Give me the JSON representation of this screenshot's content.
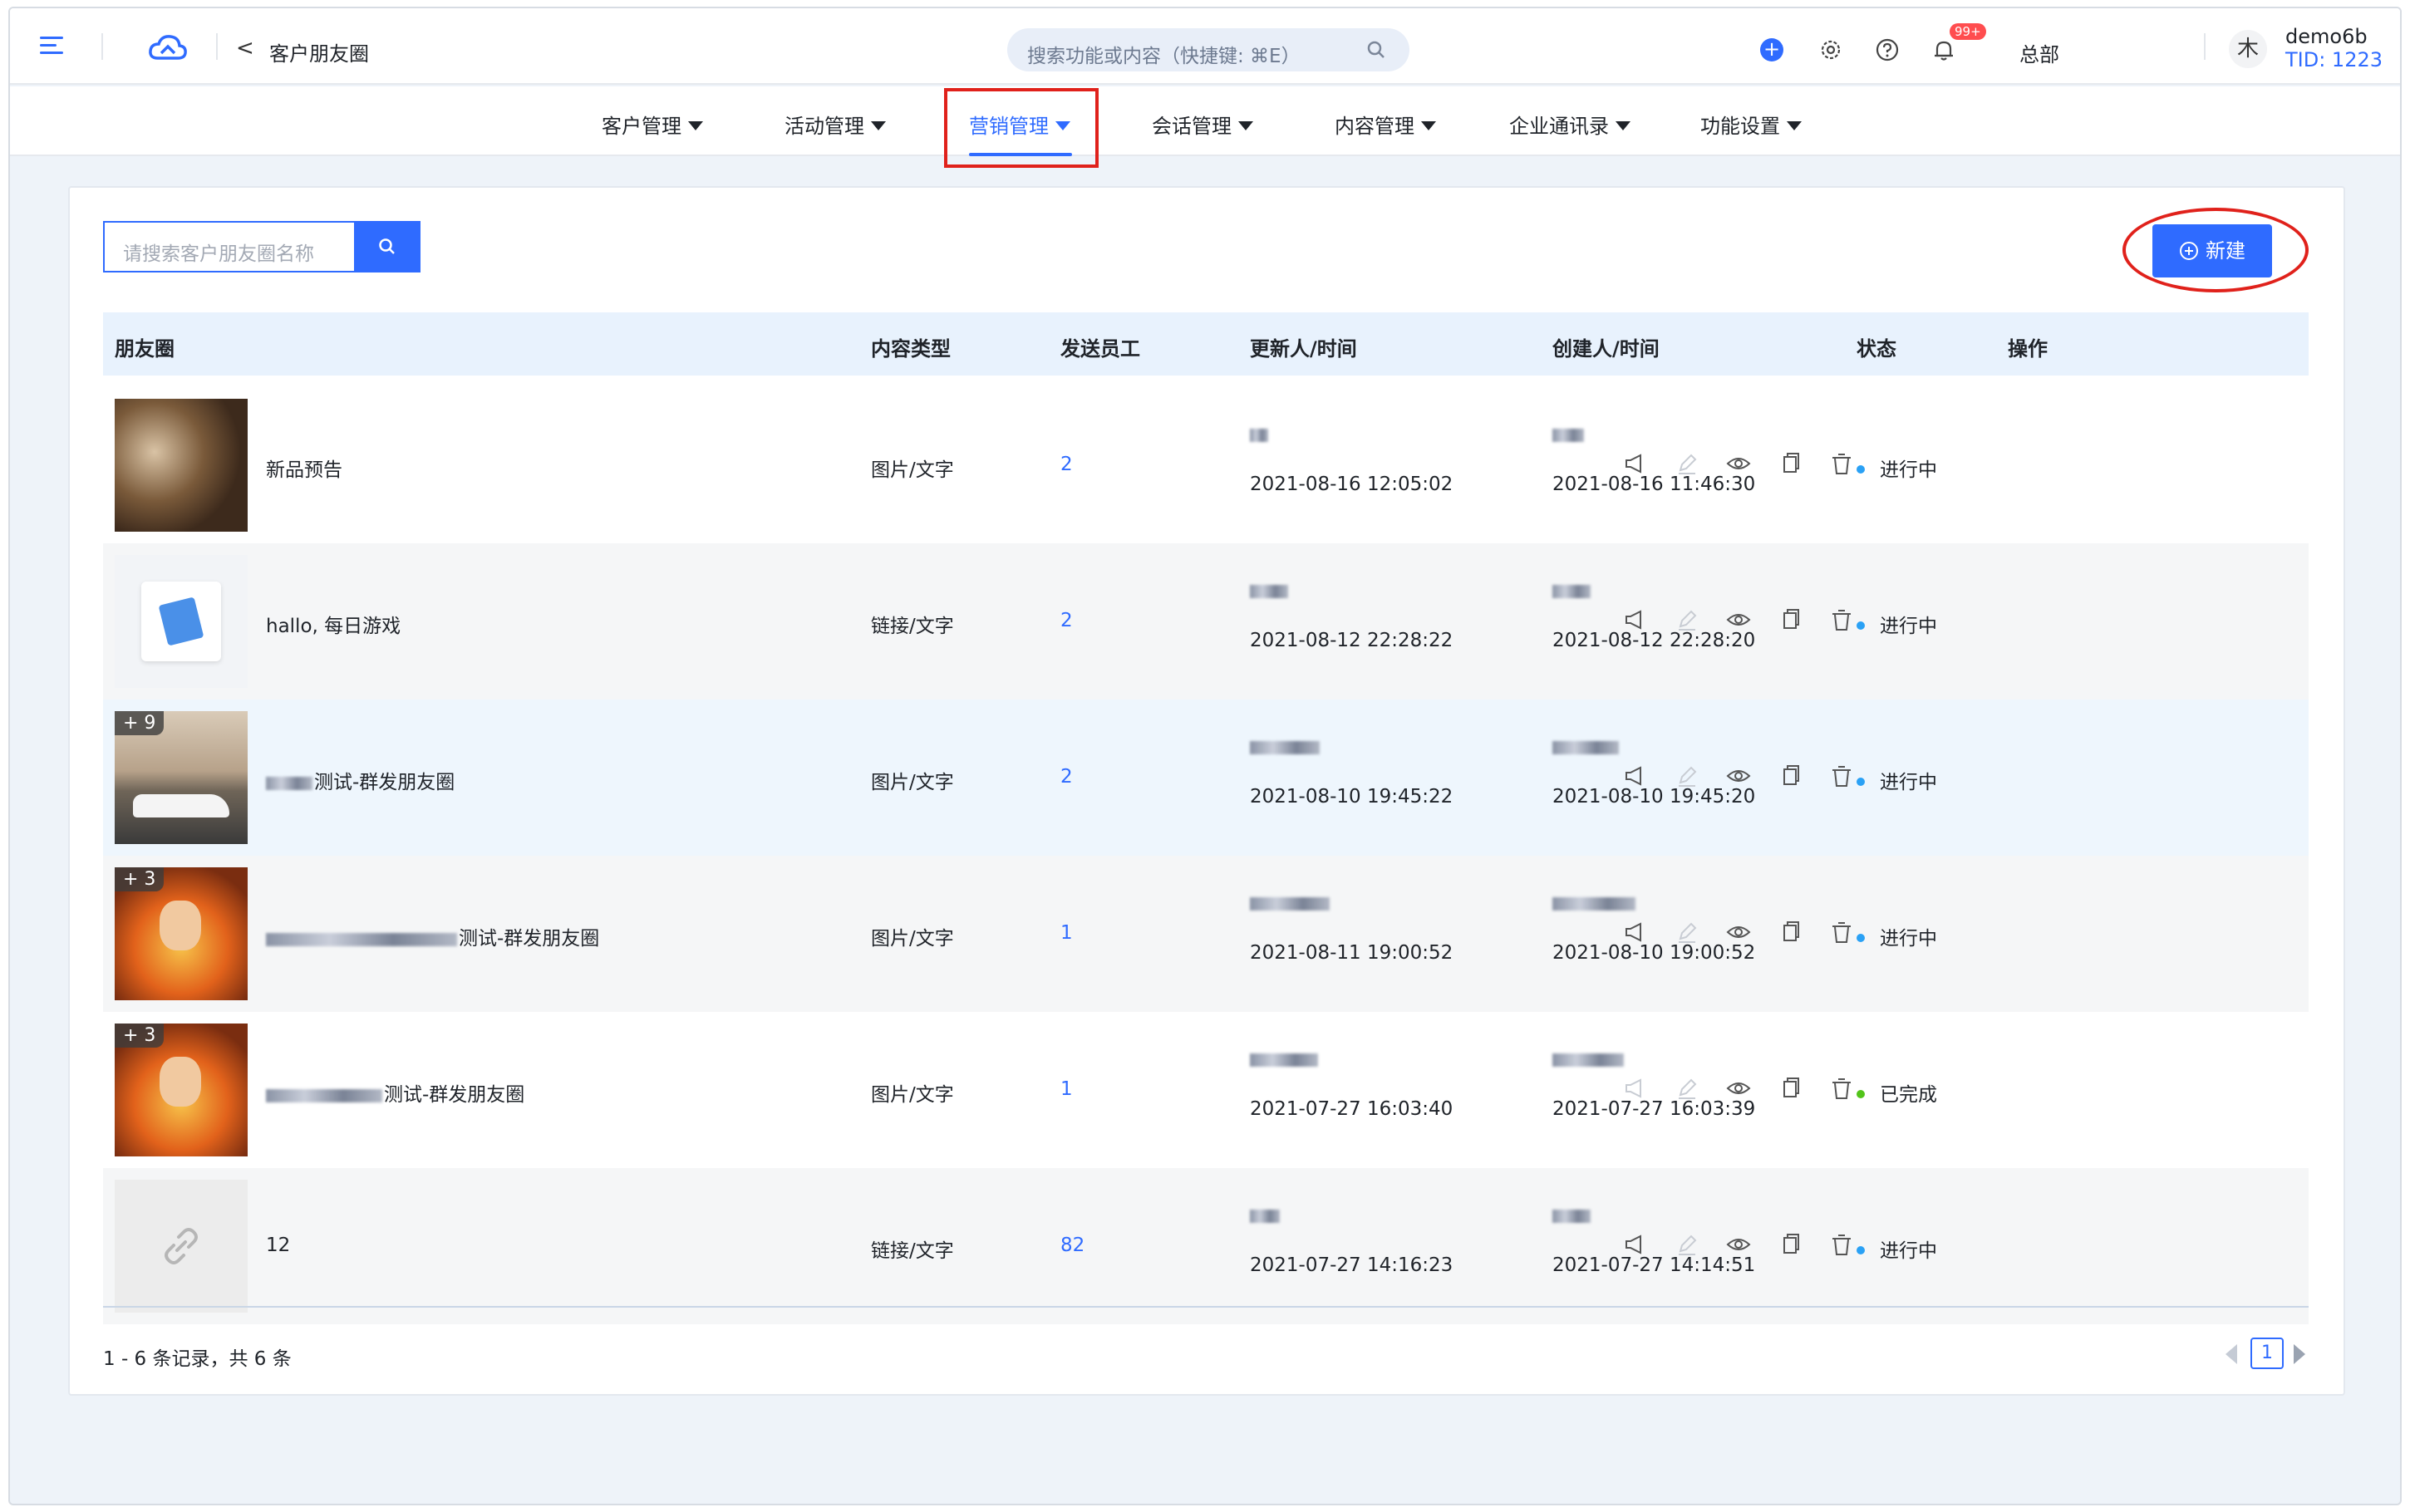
{
  "header": {
    "page_title": "客户朋友圈",
    "search_placeholder": "搜索功能或内容（快捷键: ⌘E）",
    "notification_badge": "99+",
    "org_name": "总部",
    "avatar_char": "木",
    "user_name": "demo6b",
    "user_tid": "TID: 1223"
  },
  "nav": {
    "items": [
      {
        "label": "客户管理"
      },
      {
        "label": "活动管理"
      },
      {
        "label": "营销管理",
        "active": true
      },
      {
        "label": "会话管理"
      },
      {
        "label": "内容管理"
      },
      {
        "label": "企业通讯录"
      },
      {
        "label": "功能设置"
      }
    ]
  },
  "toolbar": {
    "search_placeholder": "请搜索客户朋友圈名称",
    "new_label": "新建"
  },
  "table": {
    "headers": [
      "朋友圈",
      "内容类型",
      "发送员工",
      "更新人/时间",
      "创建人/时间",
      "状态",
      "操作"
    ],
    "rows": [
      {
        "name": "新品预告",
        "type": "图片/文字",
        "senders": "2",
        "updated": "2021-08-16 12:05:02",
        "created": "2021-08-16 11:46:30",
        "status": "进行中",
        "thumb": "food-photo"
      },
      {
        "name": "hallo, 每日游戏",
        "type": "链接/文字",
        "senders": "2",
        "updated": "2021-08-12 22:28:22",
        "created": "2021-08-12 22:28:20",
        "status": "进行中",
        "thumb": "link-card"
      },
      {
        "name": "测试-群发朋友圈",
        "type": "图片/文字",
        "senders": "2",
        "updated": "2021-08-10 19:45:22",
        "created": "2021-08-10 19:45:20",
        "status": "进行中",
        "thumb": "car-photo",
        "count": "+ 9"
      },
      {
        "name": "测试-群发朋友圈",
        "type": "图片/文字",
        "senders": "1",
        "updated": "2021-08-11 19:00:52",
        "created": "2021-08-10 19:00:52",
        "status": "进行中",
        "thumb": "anime-photo",
        "count": "+ 3"
      },
      {
        "name": "测试-群发朋友圈",
        "type": "图片/文字",
        "senders": "1",
        "updated": "2021-07-27 16:03:40",
        "created": "2021-07-27 16:03:39",
        "status": "已完成",
        "thumb": "anime-photo",
        "count": "+ 3"
      },
      {
        "name": "12",
        "type": "链接/文字",
        "senders": "82",
        "updated": "2021-07-27 14:16:23",
        "created": "2021-07-27 14:14:51",
        "status": "进行中",
        "thumb": "link-icon"
      }
    ]
  },
  "pagination": {
    "summary": "1 - 6 条记录，共 6 条",
    "current_page": "1"
  },
  "colors": {
    "accent": "#2f6bff",
    "status_running": "#2aa1f5",
    "status_done": "#52c41a",
    "annotation_red": "#e0211b"
  }
}
